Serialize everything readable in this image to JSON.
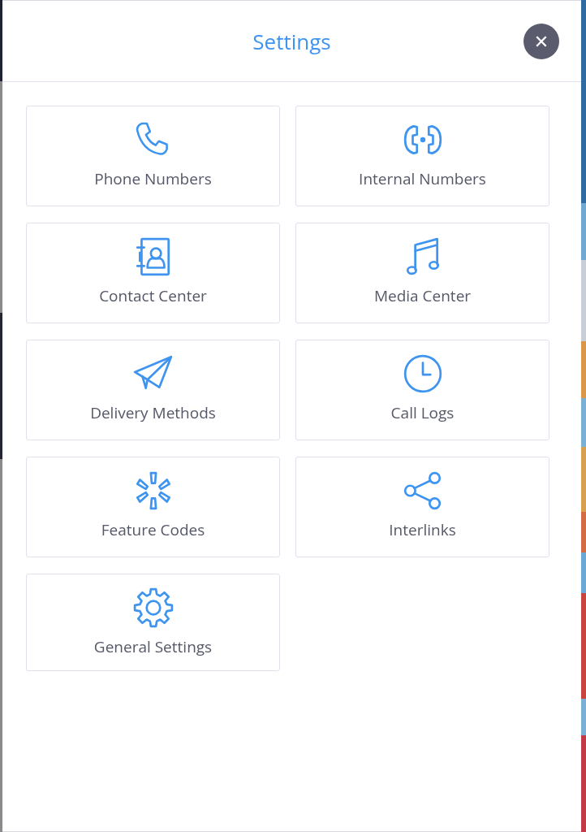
{
  "dialog": {
    "title": "Settings",
    "close_label": "✕"
  },
  "tiles": [
    {
      "label": "Phone Numbers",
      "kind": "phone"
    },
    {
      "label": "Internal Numbers",
      "kind": "internal"
    },
    {
      "label": "Contact Center",
      "kind": "contacts"
    },
    {
      "label": "Media Center",
      "kind": "music"
    },
    {
      "label": "Delivery Methods",
      "kind": "plane"
    },
    {
      "label": "Call Logs",
      "kind": "clock"
    },
    {
      "label": "Feature Codes",
      "kind": "burst"
    },
    {
      "label": "Interlinks",
      "kind": "share"
    },
    {
      "label": "General Settings",
      "kind": "gear"
    }
  ]
}
